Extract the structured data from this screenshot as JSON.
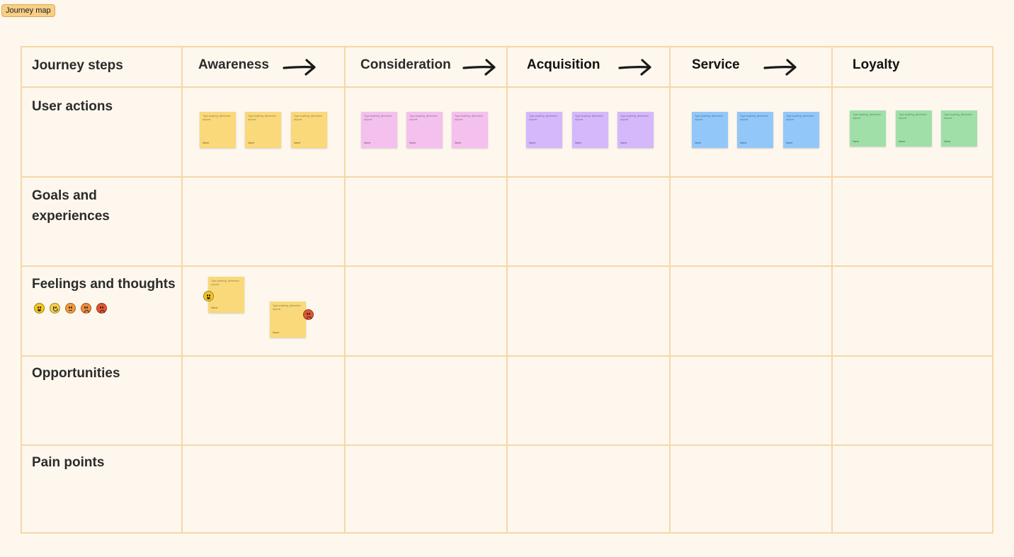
{
  "frame": {
    "label": "Journey map"
  },
  "columns": [
    {
      "label": "Awareness"
    },
    {
      "label": "Consideration"
    },
    {
      "label": "Acquisition"
    },
    {
      "label": "Service"
    },
    {
      "label": "Loyalty"
    }
  ],
  "header_cell": {
    "label": "Journey steps"
  },
  "rows": [
    {
      "label": "User actions"
    },
    {
      "label": "Goals and experiences"
    },
    {
      "label": "Feelings and thoughts"
    },
    {
      "label": "Opportunities"
    },
    {
      "label": "Pain points"
    }
  ],
  "sticky_text": "Type anything, @mention anyone",
  "sticky_author": "Name",
  "colors": {
    "yellow": "#f9d97a",
    "pink": "#f4c0ee",
    "purple": "#d4b8fb",
    "blue": "#92c7f9",
    "green": "#a0e0a8",
    "grid": "#f5d7a8",
    "background": "#fef7ee"
  },
  "feeling_emojis": [
    "very-happy-emoji",
    "happy-emoji",
    "neutral-emoji",
    "sad-emoji",
    "angry-emoji"
  ]
}
